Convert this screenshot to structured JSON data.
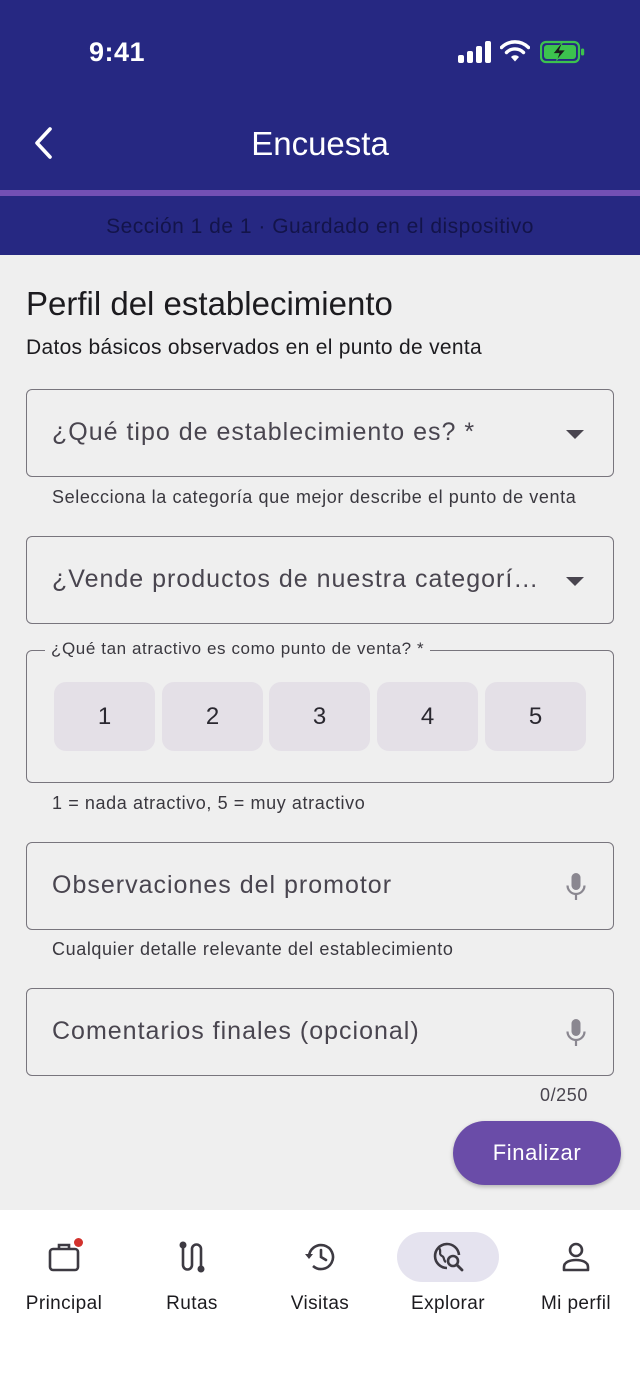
{
  "status_bar": {
    "time": "9:41"
  },
  "header": {
    "title": "Encuesta",
    "section_info": "Sección 1 de 1 · Guardado en el dispositivo"
  },
  "form": {
    "title": "Perfil del establecimiento",
    "subtitle": "Datos básicos observados en el punto de venta",
    "q1": {
      "label": "¿Qué tipo de establecimiento es? *",
      "helper": "Selecciona la categoría que mejor describe el punto de venta"
    },
    "q2": {
      "label": "¿Vende productos de nuestra categoría?"
    },
    "q3": {
      "label": "¿Qué tan atractivo es como punto de venta? *",
      "options": [
        "1",
        "2",
        "3",
        "4",
        "5"
      ],
      "helper": "1 = nada atractivo, 5 = muy atractivo"
    },
    "q4": {
      "label": "Observaciones del promotor",
      "helper": "Cualquier detalle relevante del establecimiento"
    },
    "q5": {
      "label": "Comentarios finales (opcional)",
      "counter": "0/250"
    },
    "finish_label": "Finalizar"
  },
  "nav": {
    "items": [
      {
        "label": "Principal",
        "icon": "briefcase-icon"
      },
      {
        "label": "Rutas",
        "icon": "route-icon"
      },
      {
        "label": "Visitas",
        "icon": "history-icon"
      },
      {
        "label": "Explorar",
        "icon": "explore-icon"
      },
      {
        "label": "Mi perfil",
        "icon": "person-icon"
      }
    ],
    "active_index": 3
  },
  "colors": {
    "header": "#262882",
    "accent": "#6a4ca8",
    "divider": "#7350b4",
    "badge": "#d2322d",
    "battery": "#3cc24e"
  }
}
